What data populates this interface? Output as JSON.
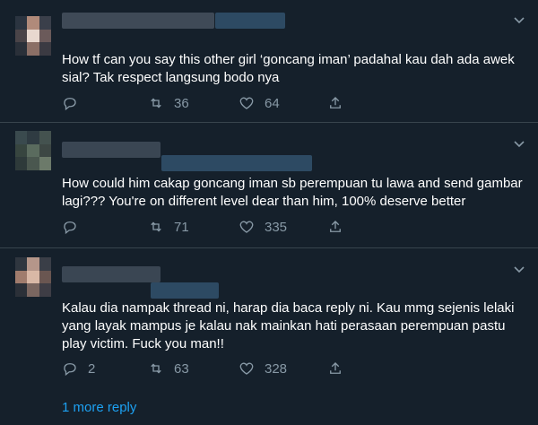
{
  "tweets": [
    {
      "text": "How tf can you say this other girl ‘goncang iman’ padahal kau dah ada awek sial? Tak respect langsung bodo nya",
      "reply_count": "",
      "retweet_count": "36",
      "like_count": "64"
    },
    {
      "text": "How could him cakap goncang iman sb perempuan tu lawa and send gambar lagi??? You're on different level dear than him, 100% deserve better",
      "reply_count": "",
      "retweet_count": "71",
      "like_count": "335"
    },
    {
      "text": "Kalau dia nampak thread ni, harap dia baca reply ni. Kau mmg sejenis lelaki yang layak mampus je kalau nak mainkan hati perasaan perempuan pastu play victim. Fuck you man!!",
      "reply_count": "2",
      "retweet_count": "63",
      "like_count": "328"
    }
  ],
  "more_replies_label": "1 more reply",
  "colors": {
    "background": "#15202b",
    "text": "#ffffff",
    "muted": "#8899a6",
    "link": "#1da1f2",
    "divider": "#38444d"
  },
  "icons": [
    "reply-icon",
    "retweet-icon",
    "like-icon",
    "share-icon",
    "chevron-down-icon"
  ]
}
